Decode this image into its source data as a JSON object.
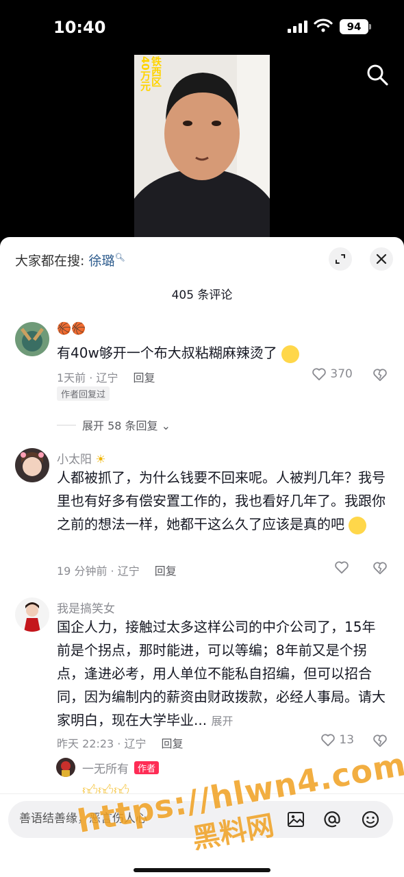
{
  "status_bar": {
    "time": "10:40",
    "battery": "94"
  },
  "video": {
    "caption": "铁西区40万元"
  },
  "sheet": {
    "trending_prefix": "大家都在搜:",
    "trending_keyword": "徐璐",
    "comment_count": "405 条评论"
  },
  "comments": [
    {
      "name": "🏀🏀",
      "text": "有40w够开一个布大叔粘糊麻辣烫了",
      "time_location": "1天前 · 辽宁",
      "reply_label": "回复",
      "likes": "370",
      "badge": "作者回复过",
      "expand_label": "展开 58 条回复"
    },
    {
      "name": "小太阳",
      "text": "人都被抓了，为什么钱要不回来呢。人被判几年？我号里也有好多有偿安置工作的，我也看好几年了。我跟你之前的想法一样，她都干这么久了应该是真的吧",
      "time_location": "19 分钟前 · 辽宁",
      "reply_label": "回复"
    },
    {
      "name": "我是搞笑女",
      "text": "国企人力，接触过太多这样公司的中介公司了，15年前是个拐点，那时能进，可以等编；8年前又是个拐点，逢进必考，用人单位不能私自招编，但可以招合同，因为编制内的薪资由财政拨款，必经人事局。请大家明白，现在大学毕业...",
      "more_label": "展开",
      "time_location": "昨天 22:23 · 辽宁",
      "reply_label": "回复",
      "likes": "13"
    },
    {
      "name": "一无所有",
      "author_tag": "作者"
    }
  ],
  "input_bar": {
    "placeholder": "善语结善缘，恶言伤人心"
  },
  "watermark": {
    "url": "https://hlwn4.com",
    "name": "黑料网"
  },
  "colors": {
    "accent": "#fe2c55",
    "link": "#2b5a8c",
    "watermark": "#f0a020"
  }
}
